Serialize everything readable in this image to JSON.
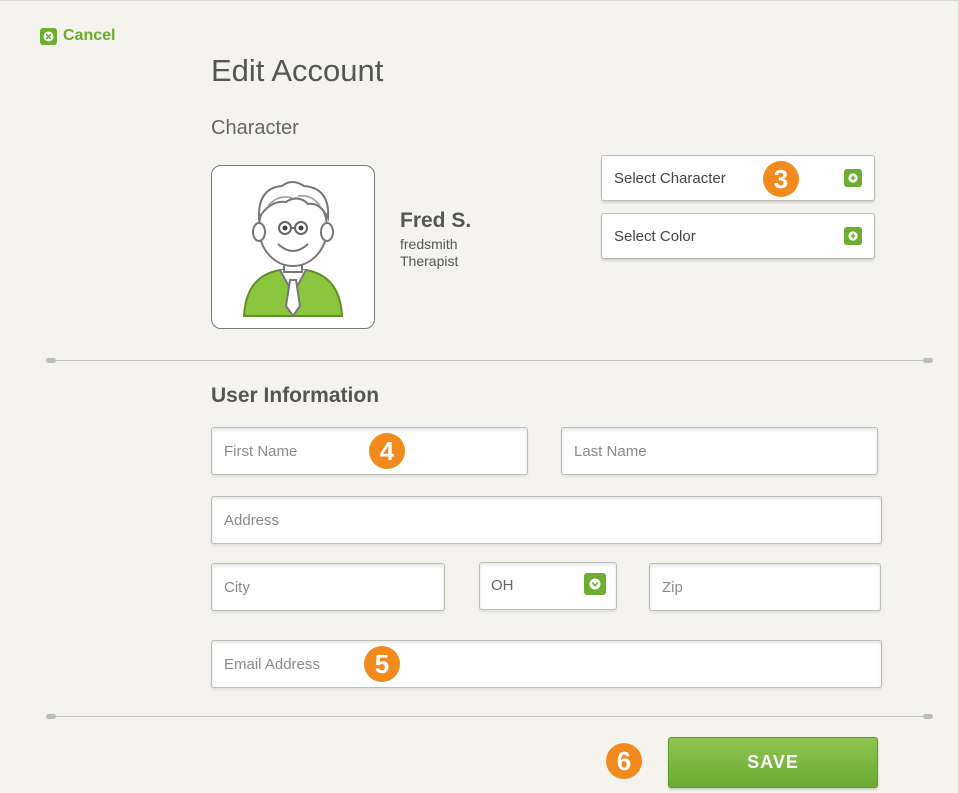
{
  "header": {
    "cancel_label": "Cancel",
    "title": "Edit Account"
  },
  "character": {
    "section_label": "Character",
    "user_name": "Fred S.",
    "username": "fredsmith",
    "role": "Therapist",
    "select_character_label": "Select Character",
    "select_color_label": "Select Color"
  },
  "user_info": {
    "heading": "User Information",
    "first_name_placeholder": "First Name",
    "last_name_placeholder": "Last Name",
    "address_placeholder": "Address",
    "city_placeholder": "City",
    "state_value": "OH",
    "zip_placeholder": "Zip",
    "email_placeholder": "Email Address"
  },
  "badges": {
    "select_character": "3",
    "first_name": "4",
    "email": "5",
    "save": "6"
  },
  "actions": {
    "save_label": "SAVE"
  },
  "colors": {
    "accent_green": "#6cae2f",
    "badge_orange": "#f28a1e",
    "background": "#f4f3ee"
  },
  "icons": {
    "cancel": "close-icon",
    "select_character": "plus-icon",
    "select_color": "plus-icon",
    "state_dropdown": "chevron-down-icon"
  }
}
